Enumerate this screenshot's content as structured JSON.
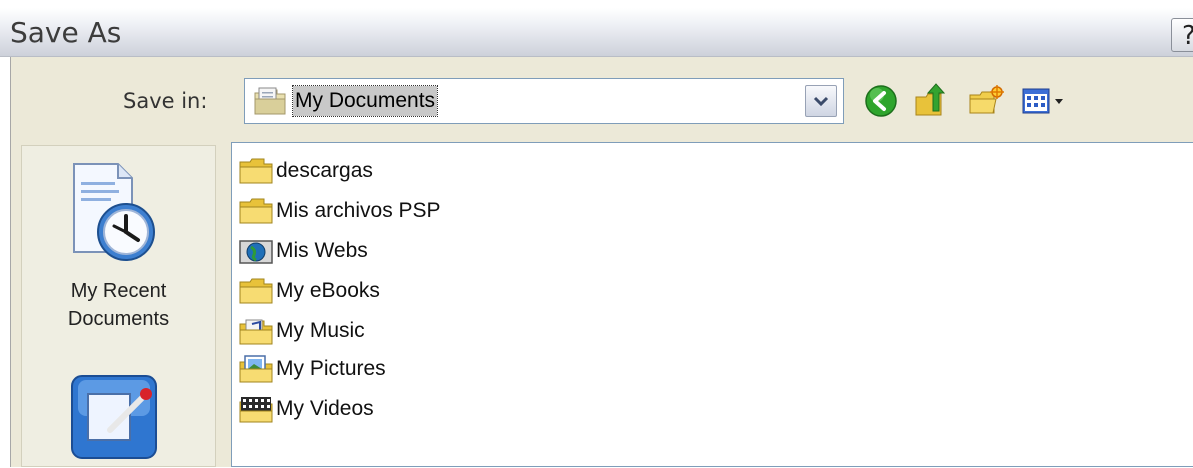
{
  "window": {
    "title": "Save As",
    "help_label": "?"
  },
  "toolbar": {
    "save_in_label": "Save in:",
    "location_value": "My Documents"
  },
  "places": [
    {
      "label_line1": "My Recent",
      "label_line2": "Documents",
      "icon": "recent-documents-icon"
    },
    {
      "label_line1": "",
      "label_line2": "",
      "icon": "desktop-icon"
    }
  ],
  "files": [
    {
      "name": "descargas",
      "icon": "folder-icon"
    },
    {
      "name": "Mis archivos PSP",
      "icon": "folder-icon"
    },
    {
      "name": "Mis Webs",
      "icon": "web-folder-icon"
    },
    {
      "name": "My eBooks",
      "icon": "folder-icon"
    },
    {
      "name": "My Music",
      "icon": "music-folder-icon"
    },
    {
      "name": "My Pictures",
      "icon": "pictures-folder-icon"
    },
    {
      "name": "My Videos",
      "icon": "videos-folder-icon"
    }
  ]
}
